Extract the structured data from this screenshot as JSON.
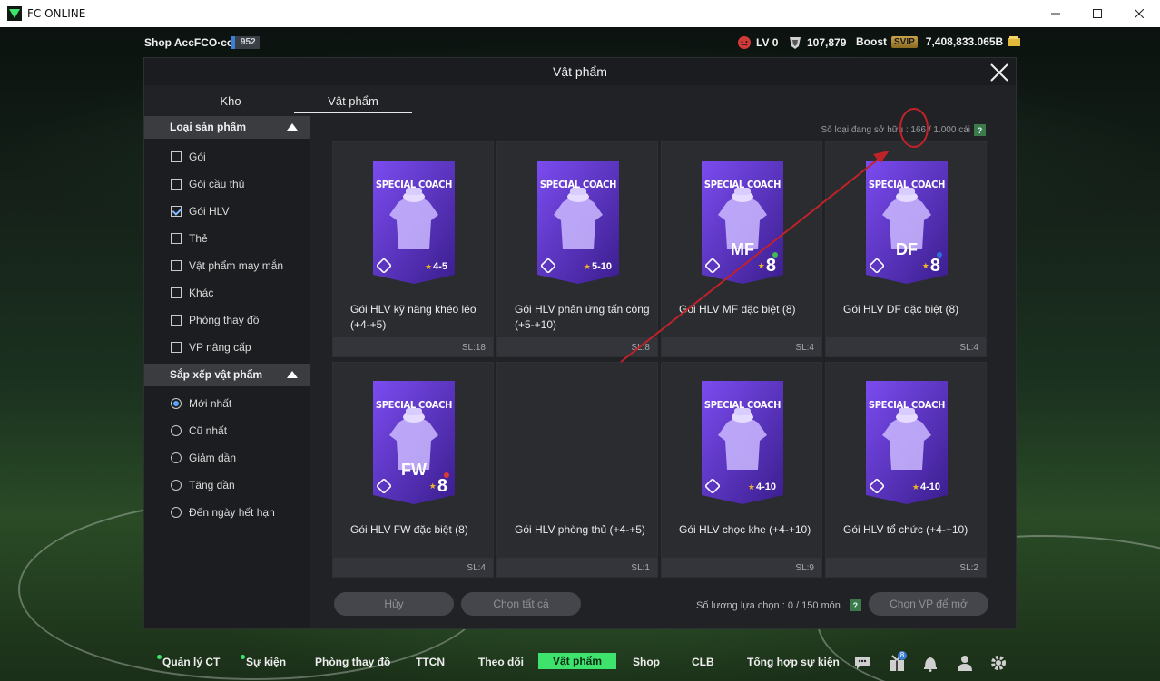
{
  "window": {
    "title": "FC ONLINE"
  },
  "topbar": {
    "shop_name": "Shop AccFCO·com",
    "shop_count": "952",
    "level": "LV 0",
    "fc_points": "107,879",
    "boost_label": "Boost",
    "svip": "SVIP",
    "bp": "7,408,833.065B"
  },
  "modal": {
    "title": "Vật phẩm",
    "tabs": [
      {
        "label": "Kho"
      },
      {
        "label": "Vật phẩm"
      }
    ],
    "owned_label": "Số loại đang sở hữu : 166 / 1.000 cái",
    "filter": {
      "title": "Loại sản phẩm",
      "options": [
        {
          "label": "Gói",
          "checked": false
        },
        {
          "label": "Gói cầu thủ",
          "checked": false
        },
        {
          "label": "Gói HLV",
          "checked": true
        },
        {
          "label": "Thẻ",
          "checked": false
        },
        {
          "label": "Vật phẩm may mắn",
          "checked": false
        },
        {
          "label": "Khác",
          "checked": false
        },
        {
          "label": "Phòng thay đồ",
          "checked": false
        },
        {
          "label": "VP nâng cấp",
          "checked": false
        }
      ]
    },
    "sort": {
      "title": "Sắp xếp vật phẩm",
      "options": [
        {
          "label": "Mới nhất",
          "selected": true
        },
        {
          "label": "Cũ nhất",
          "selected": false
        },
        {
          "label": "Giảm dần",
          "selected": false
        },
        {
          "label": "Tăng dần",
          "selected": false
        },
        {
          "label": "Đến ngày hết hạn",
          "selected": false
        }
      ]
    },
    "items": [
      {
        "name": "Gói HLV kỹ năng khéo léo (+4-+5)",
        "qty": "SL:18",
        "card_title": "SPECIAL COACH",
        "pos": "",
        "value": "4-5",
        "star": true,
        "dot": ""
      },
      {
        "name": "Gói HLV phản ứng tấn công (+5-+10)",
        "qty": "SL:8",
        "card_title": "SPECIAL COACH",
        "pos": "",
        "value": "5-10",
        "star": true,
        "dot": ""
      },
      {
        "name": "Gói HLV MF đặc biệt (8)",
        "qty": "SL:4",
        "card_title": "SPECIAL COACH",
        "pos": "MF",
        "value": "8",
        "star": true,
        "dot": "#3fb950"
      },
      {
        "name": "Gói HLV DF đặc biệt (8)",
        "qty": "SL:4",
        "card_title": "SPECIAL COACH",
        "pos": "DF",
        "value": "8",
        "star": true,
        "dot": "#2f6fe0"
      },
      {
        "name": "Gói HLV FW đặc biệt (8)",
        "qty": "SL:4",
        "card_title": "SPECIAL COACH",
        "pos": "FW",
        "value": "8",
        "star": true,
        "dot": "#e0392f"
      },
      {
        "name": "Gói HLV phòng thủ (+4-+5)",
        "qty": "SL:1",
        "card_title": "",
        "pos": "",
        "value": "",
        "star": false,
        "dot": ""
      },
      {
        "name": "Gói HLV chọc khe (+4-+10)",
        "qty": "SL:9",
        "card_title": "SPECIAL COACH",
        "pos": "",
        "value": "4-10",
        "star": true,
        "dot": ""
      },
      {
        "name": "Gói HLV tổ chức (+4-+10)",
        "qty": "SL:2",
        "card_title": "SPECIAL COACH",
        "pos": "",
        "value": "4-10",
        "star": true,
        "dot": ""
      }
    ],
    "buttons": {
      "cancel": "Hủy",
      "select_all": "Chọn tất cả",
      "open": "Chọn VP để mở"
    },
    "select_count": "Số lượng lựa chọn : 0 / 150 món"
  },
  "bottomnav": {
    "items": [
      {
        "label": "Quản lý CT",
        "dot": true
      },
      {
        "label": "Sự kiện",
        "dot": true
      },
      {
        "label": "Phòng thay đồ",
        "dot": false
      },
      {
        "label": "TTCN",
        "dot": false
      },
      {
        "label": "Theo dõi",
        "dot": false
      },
      {
        "label": "Vật phẩm",
        "dot": false,
        "active": true
      },
      {
        "label": "Shop",
        "dot": false
      },
      {
        "label": "CLB",
        "dot": false
      },
      {
        "label": "Tổng hợp sự kiện",
        "dot": false
      }
    ],
    "notif_badge": "8",
    "icons": [
      "chat-icon",
      "gift-icon",
      "bell-icon",
      "profile-icon",
      "settings-icon"
    ]
  },
  "colors": {
    "accent": "#3ee36d",
    "card_purple": "#6b3fd6",
    "annotation": "#c0222a"
  }
}
